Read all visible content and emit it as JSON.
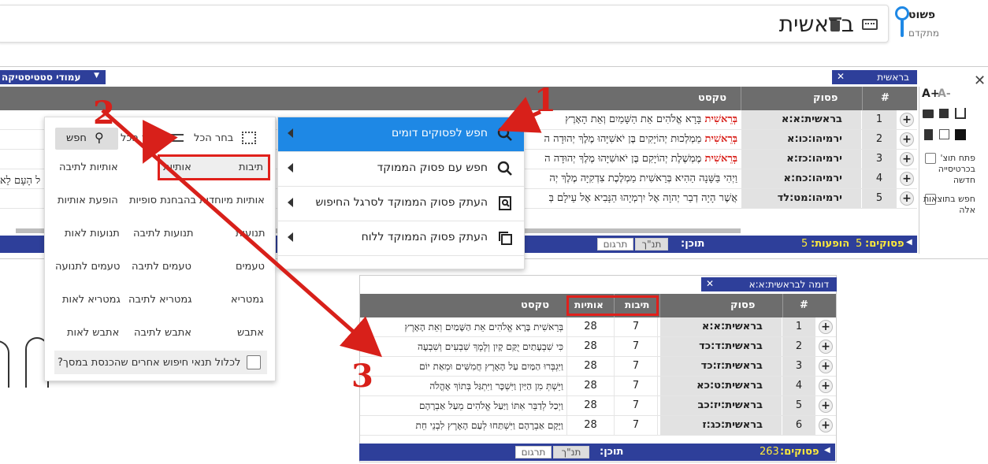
{
  "search": {
    "query": "בראשית",
    "mode_simple": "פשוט",
    "mode_advanced": "מתקדם"
  },
  "main_panel": {
    "tab_label": "בראשית",
    "stats_label": "עמודי סטטיסטיקה",
    "headers": {
      "num": "#",
      "verse": "פסוק",
      "text": "טקסט"
    },
    "rows": [
      {
        "num": "1",
        "verse": "בראשית:א:א",
        "hl": "בְּרֵאשִׁית",
        "text": " בָּרָא אֱלֹהִים אֵת הַשָּׁמַיִם וְאֵת הָאָרֶץ"
      },
      {
        "num": "2",
        "verse": "ירמיהו:כו:א",
        "hl": "בְּרֵאשִׁית",
        "text": " מַמְלְכוּת יְהוֹיָקִים בֶּן יֹאשִׁיָּהוּ מֶלֶךְ יְהוּדָה ה"
      },
      {
        "num": "3",
        "verse": "ירמיהו:כז:א",
        "hl": "בְּרֵאשִׁית",
        "text": " מֶמְשֶׁלֶת יְהוֹיָקִם בֶּן יֹאושִׁיָּהוּ מֶלֶךְ יְהוּדָה ה"
      },
      {
        "num": "4",
        "verse": "ירמיהו:כח:א",
        "hl": "",
        "text": "וַיְהִי בַּשָּׁנָה הַהִיא בְּרֵאשִׁית מַמְלֶכֶת צִדְקִיָּה מֶלֶךְ יְה"
      },
      {
        "num": "5",
        "verse": "ירמיהו:מט:לד",
        "hl": "",
        "text": "אֲשֶׁר הָיָה דְבַר יְהוָה אֶל יִרְמְיָהוּ הַנָּבִיא אֶל עֵילָם בְּ"
      }
    ],
    "side_text": "ל הָעָם לֵא",
    "footer": {
      "verses_label": "פסוקים:",
      "verses_value": "5",
      "hits_label": "הופעות:",
      "hits_value": "5",
      "content_label": "תוכן:",
      "btn_tanakh": "תנ\"ך",
      "btn_translation": "תרגום"
    }
  },
  "right_tools": {
    "font_inc": "A+",
    "font_dec": "A-",
    "open_new_tab": "פתח תוצ' בכרטיסייה חדשה",
    "search_in_results": "חפש בתוצאות אלה"
  },
  "context_menu": {
    "items": [
      {
        "label": "חפש לפסוקים דומים",
        "icon": "search-icon"
      },
      {
        "label": "חפש עם פסוק הממוקד",
        "icon": "search-icon"
      },
      {
        "label": "העתק פסוק הממוקד לסרגל החיפוש",
        "icon": "copy-to-search-icon"
      },
      {
        "label": "העתק פסוק הממוקד ללוח",
        "icon": "copy-icon"
      }
    ]
  },
  "options_menu": {
    "select_all": "בחר הכל",
    "clear_all": "הסר הכל",
    "search_btn": "חפש",
    "words": "תיבות",
    "letters": "אותיות",
    "letters_per_word": "אותיות לתיבה",
    "special_letters": "אותיות מיוחדות",
    "final_letters": "בהבחנת סופיות",
    "letter_occurrence": "הופעת אותיות",
    "vowels": "תנועות",
    "vowels_per_word": "תנועות לתיבה",
    "vowels_per_letter": "תנועות לאות",
    "cantillation": "טעמים",
    "cantillation_per_word": "טעמים לתיבה",
    "cantillation_per_vowel": "טעמים לתנועה",
    "gematria": "גמטריא",
    "gematria_per_word": "גמטריא לתיבה",
    "gematria_per_letter": "גמטריא לאות",
    "atbash": "אתבש",
    "atbash_per_word": "אתבש לתיבה",
    "atbash_per_letter": "אתבש לאות",
    "include_other": "לכלול תנאי חיפוש אחרים שהכנסת במסך?"
  },
  "similar_panel": {
    "tab_label": "דומה לבראשית:א:א",
    "headers": {
      "num": "#",
      "verse": "פסוק",
      "words": "תיבות",
      "letters": "אותיות",
      "text": "טקסט"
    },
    "rows": [
      {
        "num": "1",
        "verse": "בראשית:א:א",
        "words": "7",
        "letters": "28",
        "text": "בְּרֵאשִׁית בָּרָא אֱלֹהִים אֵת הַשָּׁמַיִם וְאֵת הָאָרֶץ"
      },
      {
        "num": "2",
        "verse": "בראשית:ד:כד",
        "words": "7",
        "letters": "28",
        "text": "כִּי שִׁבְעָתַיִם יֻקַּם קָיִן וְלֶמֶךְ שִׁבְעִים וְשִׁבְעָה"
      },
      {
        "num": "3",
        "verse": "בראשית:ז:כד",
        "words": "7",
        "letters": "28",
        "text": "וַיִּגְבְּרוּ הַמַּיִם עַל הָאָרֶץ חֲמִשִּׁים וּמְאַת יוֹם"
      },
      {
        "num": "4",
        "verse": "בראשית:ט:כא",
        "words": "7",
        "letters": "28",
        "text": "וַיֵּשְׁתְּ מִן הַיַּיִן וַיִּשְׁכָּר וַיִּתְגַּל בְּתוֹךְ אָהֳלֹה"
      },
      {
        "num": "5",
        "verse": "בראשית:יז:כב",
        "words": "7",
        "letters": "28",
        "text": "וַיְכַל לְדַבֵּר אִתּוֹ וַיַּעַל אֱלֹהִים מֵעַל אַבְרָהָם"
      },
      {
        "num": "6",
        "verse": "בראשית:כג:ז",
        "words": "7",
        "letters": "28",
        "text": "וַיָּקָם אַבְרָהָם וַיִּשְׁתַּחוּ לְעַם הָאָרֶץ לִבְנֵי חֵת"
      }
    ],
    "footer": {
      "verses_label": "פסוקים:",
      "verses_value": "263",
      "content_label": "תוכן:",
      "btn_tanakh": "תנ\"ך",
      "btn_translation": "תרגום"
    }
  },
  "annotations": {
    "n1": "1",
    "n2": "2",
    "n3": "3",
    "color": "#d8201a"
  }
}
